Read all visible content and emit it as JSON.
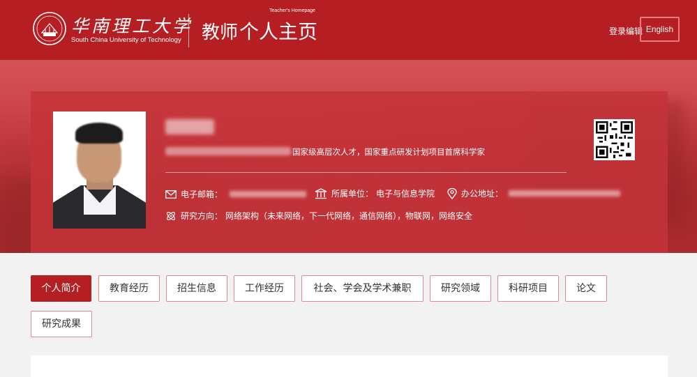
{
  "header": {
    "university_cn": "华南理工大学",
    "university_en": "South China University of Technology",
    "homepage_title": "教师",
    "homepage_title_2": "个人主页",
    "homepage_subtitle": "Teacher's Homepage",
    "login_label": "登录编辑",
    "lang_label": "English"
  },
  "profile": {
    "title_visible": "国家级高层次人才，国家重点研发计划项目首席科学家",
    "email_label": "电子邮箱：",
    "unit_label": "所属单位：",
    "unit_value": "电子与信息学院",
    "office_label": "办公地址：",
    "research_label": "研究方向：",
    "research_value": "网络架构（未来网络，下一代网络，通信网络），物联网，网络安全"
  },
  "tabs": [
    {
      "label": "个人简介",
      "active": true
    },
    {
      "label": "教育经历",
      "active": false
    },
    {
      "label": "招生信息",
      "active": false
    },
    {
      "label": "工作经历",
      "active": false
    },
    {
      "label": "社会、学会及学术兼职",
      "active": false
    },
    {
      "label": "研究领域",
      "active": false
    },
    {
      "label": "科研项目",
      "active": false
    },
    {
      "label": "论文",
      "active": false
    },
    {
      "label": "研究成果",
      "active": false
    }
  ],
  "colors": {
    "brand_red": "#b51f23",
    "tab_border": "#d98a8d",
    "lang_button_border": "#f07a82"
  },
  "icons": [
    "university-seal-icon",
    "email-icon",
    "building-icon",
    "location-pin-icon",
    "atom-icon",
    "qr-code-icon"
  ]
}
